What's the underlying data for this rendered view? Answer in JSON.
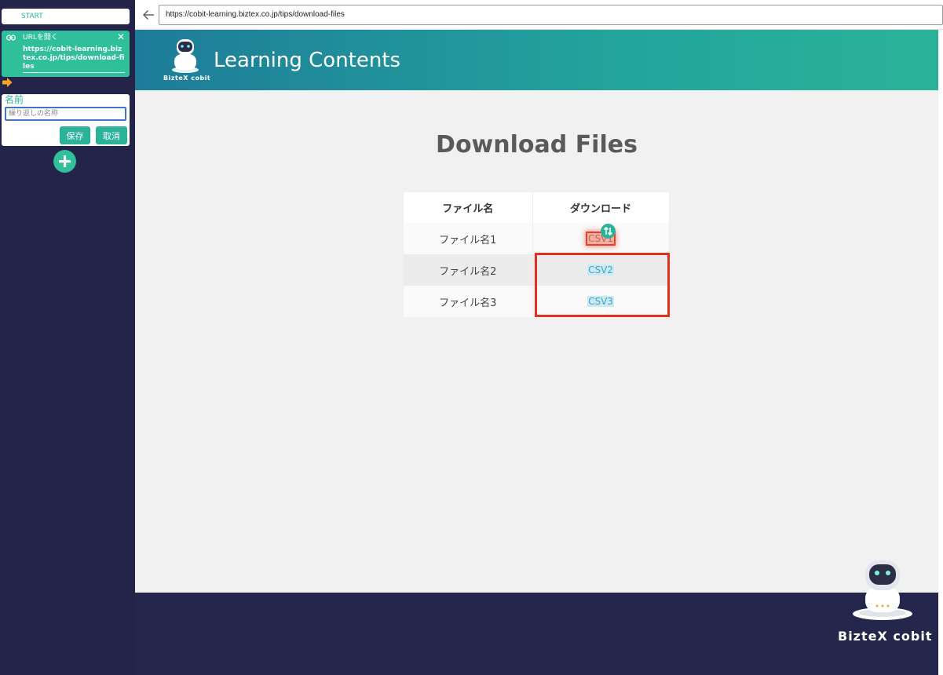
{
  "editor": {
    "start_label": "START",
    "url_block": {
      "title": "URLを開く",
      "close": "✕",
      "url": "https://cobit-learning.biztex.co.jp/tips/download-files"
    },
    "loop_form": {
      "label": "名前",
      "placeholder": "繰り返しの名称",
      "save_label": "保存",
      "cancel_label": "取消"
    }
  },
  "browser": {
    "url": "https://cobit-learning.biztex.co.jp/tips/download-files"
  },
  "site": {
    "logo_text": "BizteX cobit",
    "title": "Learning Contents",
    "page_title": "Download Files",
    "table": {
      "headers": [
        "ファイル名",
        "ダウンロード"
      ],
      "rows": [
        {
          "name": "ファイル名1",
          "link": "CSV1"
        },
        {
          "name": "ファイル名2",
          "link": "CSV2"
        },
        {
          "name": "ファイル名3",
          "link": "CSV3"
        }
      ]
    },
    "footer_logo_text": "BizteX cobit"
  },
  "colors": {
    "panel_bg": "#24234a",
    "accent_green": "#2bb39a",
    "selection_red": "#e0321c",
    "footer_bg": "#24264b"
  }
}
